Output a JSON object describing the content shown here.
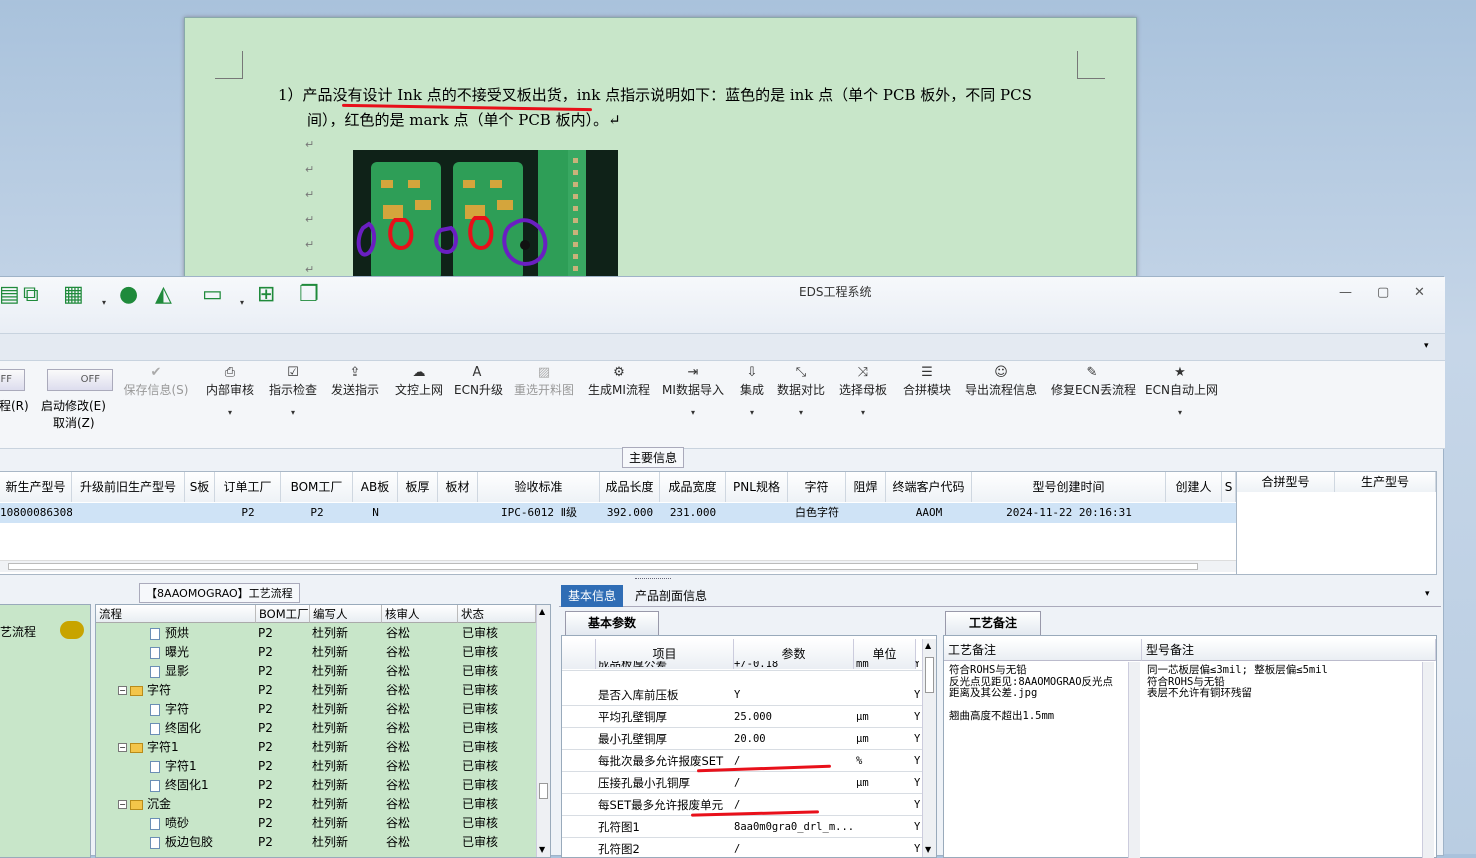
{
  "doc": {
    "line1": "1）产品没有设计 Ink 点的不接受叉板出货，ink 点指示说明如下：蓝色的是 ink 点（单个 PCB 板外，不同 PCS",
    "line2": "间），红色的是 mark 点（单个 PCB 板内）。↵",
    "return_mark": "↵"
  },
  "window": {
    "title": "EDS工程系统",
    "minimize": "—",
    "maximize": "▢",
    "close": "✕"
  },
  "ribbon": {
    "toggle1": "OFF",
    "toggle1_label": "程(R)",
    "toggle2": "OFF",
    "toggle2_label": "启动修改(E)",
    "toggle2_sub": "取消(Z)",
    "buttons": [
      {
        "label": "保存信息(S)",
        "icon": "check-icon"
      },
      {
        "label": "内部审核",
        "icon": "printer-icon"
      },
      {
        "label": "指示检查",
        "icon": "checkbox-icon"
      },
      {
        "label": "发送指示",
        "icon": "upload-icon"
      },
      {
        "label": "文控上网",
        "icon": "cloud-upload-icon"
      },
      {
        "label": "ECN升级",
        "icon": "letter-a-icon"
      },
      {
        "label": "重选开料图",
        "icon": "image-icon"
      },
      {
        "label": "生成MI流程",
        "icon": "gears-icon"
      },
      {
        "label": "MI数据导入",
        "icon": "import-icon"
      },
      {
        "label": "集成",
        "icon": "download-icon"
      },
      {
        "label": "数据对比",
        "icon": "compress-icon"
      },
      {
        "label": "选择母板",
        "icon": "shuffle-icon"
      },
      {
        "label": "合拼模块",
        "icon": "list-icon"
      },
      {
        "label": "导出流程信息",
        "icon": "smile-icon"
      },
      {
        "label": "修复ECN丢流程",
        "icon": "wrench-icon"
      },
      {
        "label": "ECN自动上网",
        "icon": "star-icon"
      }
    ],
    "dropdown_glyph": "▾"
  },
  "main": {
    "label": "主要信息",
    "columns": [
      "新生产型号",
      "升级前旧生产型号",
      "S板",
      "订单工厂",
      "BOM工厂",
      "AB板",
      "板厚",
      "板材",
      "验收标准",
      "成品长度",
      "成品宽度",
      "PNL规格",
      "字符",
      "阻焊",
      "终端客户代码",
      "型号创建时间",
      "创建人",
      "S"
    ],
    "row": [
      "10800086308",
      "",
      "",
      "P2",
      "P2",
      "N",
      "",
      "",
      "IPC-6012 Ⅱ级",
      "392.000",
      "231.000",
      "",
      "白色字符",
      "",
      "AAOM",
      "2024-11-22 20:16:31",
      "",
      ""
    ],
    "side_columns": [
      "合拼型号",
      "生产型号"
    ]
  },
  "flow": {
    "title": "【8AAOMOGRAO】工艺流程",
    "side_label": "艺流程",
    "columns": [
      "流程",
      "BOM工厂",
      "编写人",
      "核审人",
      "状态"
    ],
    "rows": [
      {
        "name": "预烘",
        "factory": "P2",
        "writer": "杜列新",
        "checker": "谷松",
        "status": "已审核",
        "type": "file"
      },
      {
        "name": "曝光",
        "factory": "P2",
        "writer": "杜列新",
        "checker": "谷松",
        "status": "已审核",
        "type": "file"
      },
      {
        "name": "显影",
        "factory": "P2",
        "writer": "杜列新",
        "checker": "谷松",
        "status": "已审核",
        "type": "file"
      },
      {
        "name": "字符",
        "factory": "P2",
        "writer": "杜列新",
        "checker": "谷松",
        "status": "已审核",
        "type": "folder"
      },
      {
        "name": "字符",
        "factory": "P2",
        "writer": "杜列新",
        "checker": "谷松",
        "status": "已审核",
        "type": "file"
      },
      {
        "name": "终固化",
        "factory": "P2",
        "writer": "杜列新",
        "checker": "谷松",
        "status": "已审核",
        "type": "file"
      },
      {
        "name": "字符1",
        "factory": "P2",
        "writer": "杜列新",
        "checker": "谷松",
        "status": "已审核",
        "type": "folder"
      },
      {
        "name": "字符1",
        "factory": "P2",
        "writer": "杜列新",
        "checker": "谷松",
        "status": "已审核",
        "type": "file"
      },
      {
        "name": "终固化1",
        "factory": "P2",
        "writer": "杜列新",
        "checker": "谷松",
        "status": "已审核",
        "type": "file"
      },
      {
        "name": "沉金",
        "factory": "P2",
        "writer": "杜列新",
        "checker": "谷松",
        "status": "已审核",
        "type": "folder"
      },
      {
        "name": "喷砂",
        "factory": "P2",
        "writer": "杜列新",
        "checker": "谷松",
        "status": "已审核",
        "type": "file"
      },
      {
        "name": "板边包胶",
        "factory": "P2",
        "writer": "杜列新",
        "checker": "谷松",
        "status": "已审核",
        "type": "file"
      }
    ]
  },
  "basic": {
    "tab_basic": "基本信息",
    "tab_profile": "产品剖面信息",
    "subtab": "基本参数",
    "columns": [
      "项目",
      "参数",
      "单位"
    ],
    "rows": [
      {
        "item": "成品板厚公差",
        "value": "+/-0.18",
        "unit": "mm",
        "flag": "Y"
      },
      {
        "item": "是否入库前压板",
        "value": "Y",
        "unit": "",
        "flag": "Y"
      },
      {
        "item": "平均孔壁铜厚",
        "value": "25.000",
        "unit": "μm",
        "flag": "Y"
      },
      {
        "item": "最小孔壁铜厚",
        "value": "20.00",
        "unit": "μm",
        "flag": "Y"
      },
      {
        "item": "每批次最多允许报废SET",
        "value": "/",
        "unit": "%",
        "flag": "Y"
      },
      {
        "item": "压接孔最小孔铜厚",
        "value": "/",
        "unit": "μm",
        "flag": "Y"
      },
      {
        "item": "每SET最多允许报废单元",
        "value": "/",
        "unit": "",
        "flag": "Y"
      },
      {
        "item": "孔符图1",
        "value": "8aa0m0gra0_drl_m...",
        "unit": "",
        "flag": "Y"
      },
      {
        "item": "孔符图2",
        "value": "/",
        "unit": "",
        "flag": "Y"
      }
    ]
  },
  "notes": {
    "tab": "工艺备注",
    "col1": "工艺备注",
    "col2": "型号备注",
    "text1": "符合ROHS与无铅\n反光点见距见:8AAOMOGRAO反光点\n距离及其公差.jpg\n\n翘曲高度不超出1.5mm",
    "text2": "同一芯板层偏≤3mil; 整板层偏≤5mil\n符合ROHS与无铅\n表层不允许有铜环残留"
  },
  "colors": {
    "accent": "#2f6db5",
    "panel_green": "#c8e6c9",
    "annotation_red": "#e8101a",
    "annotation_purple": "#6a1fc2"
  }
}
